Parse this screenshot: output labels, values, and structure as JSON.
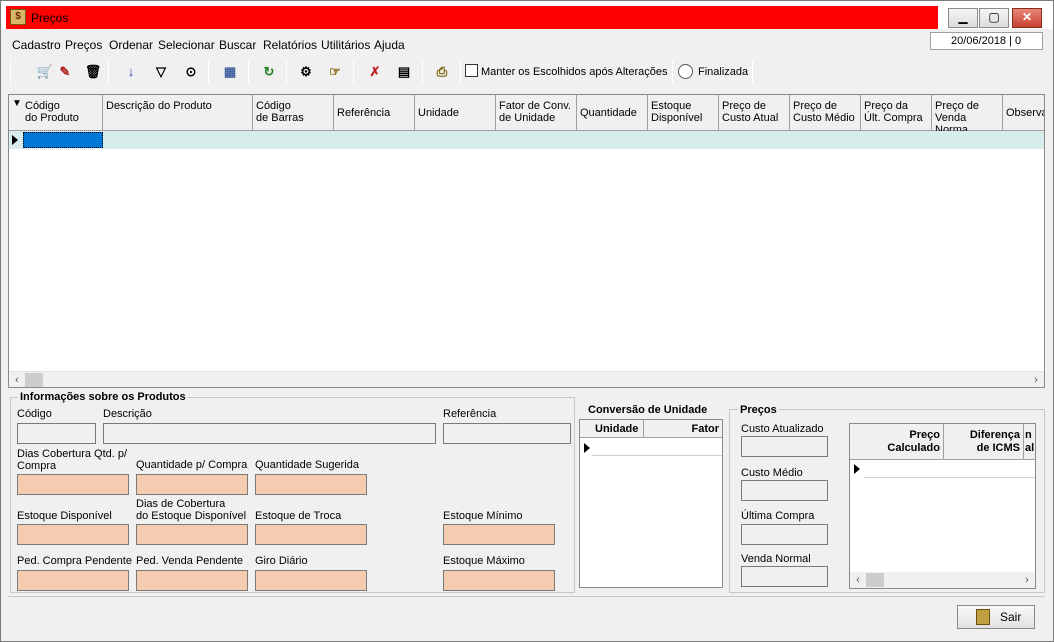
{
  "window": {
    "title": "Preços",
    "minimize": "▁",
    "maximize": "▢",
    "close": "✕",
    "app_icon": "$"
  },
  "menu": [
    "Cadastro",
    "Preços",
    "Ordenar",
    "Selecionar",
    "Buscar",
    "Relatórios",
    "Utilitários",
    "Ajuda"
  ],
  "status_date": "20/06/2018 | 0",
  "toolbar": {
    "icons": [
      "cart-add-icon",
      "cart-edit-icon",
      "trash-icon",
      "sort-az-icon",
      "filter-icon",
      "binoculars-icon",
      "table-icon",
      "refresh-icon",
      "gears-icon",
      "select-icon",
      "checkmark-x-icon",
      "document-icon",
      "print-icon"
    ],
    "keep_selected_label": "Manter os Escolhidos após Alterações",
    "finalizada_label": "Finalizada"
  },
  "grid": {
    "columns": [
      "Código\ndo Produto",
      "Descrição do Produto",
      "Código\nde Barras",
      "Referência",
      "Unidade",
      "Fator de Conv.\nde Unidade",
      "Quantidade",
      "Estoque\nDisponível",
      "Preço de\nCusto Atual",
      "Preço de\nCusto Médio",
      "Preço da\nÚlt. Compra",
      "Preço de\nVenda Norma",
      "Observa"
    ]
  },
  "info": {
    "title": "Informações sobre os Produtos",
    "codigo": "Código",
    "descricao": "Descrição",
    "referencia": "Referência",
    "dias_cobertura": "Dias Cobertura Qtd. p/\nCompra",
    "qtd_compra": "Quantidade p/ Compra",
    "qtd_sugerida": "Quantidade Sugerida",
    "estoque_disponivel": "Estoque Disponível",
    "dias_cobertura_estoque": "Dias de Cobertura\ndo Estoque Disponível",
    "estoque_troca": "Estoque de Troca",
    "estoque_minimo": "Estoque Mínimo",
    "ped_compra": "Ped. Compra Pendente",
    "ped_venda": "Ped. Venda Pendente",
    "giro": "Giro Diário",
    "estoque_maximo": "Estoque Máximo"
  },
  "conversao": {
    "title": "Conversão de Unidade",
    "columns": [
      "Unidade",
      "Fator"
    ]
  },
  "precos": {
    "title": "Preços",
    "custo_atualizado": "Custo Atualizado",
    "custo_medio": "Custo Médio",
    "ultima_compra": "Última Compra",
    "venda_normal": "Venda Normal",
    "columns": [
      "Preço\nCalculado",
      "Diferença\nde ICMS",
      "n\nal"
    ]
  },
  "sair_label": "Sair"
}
